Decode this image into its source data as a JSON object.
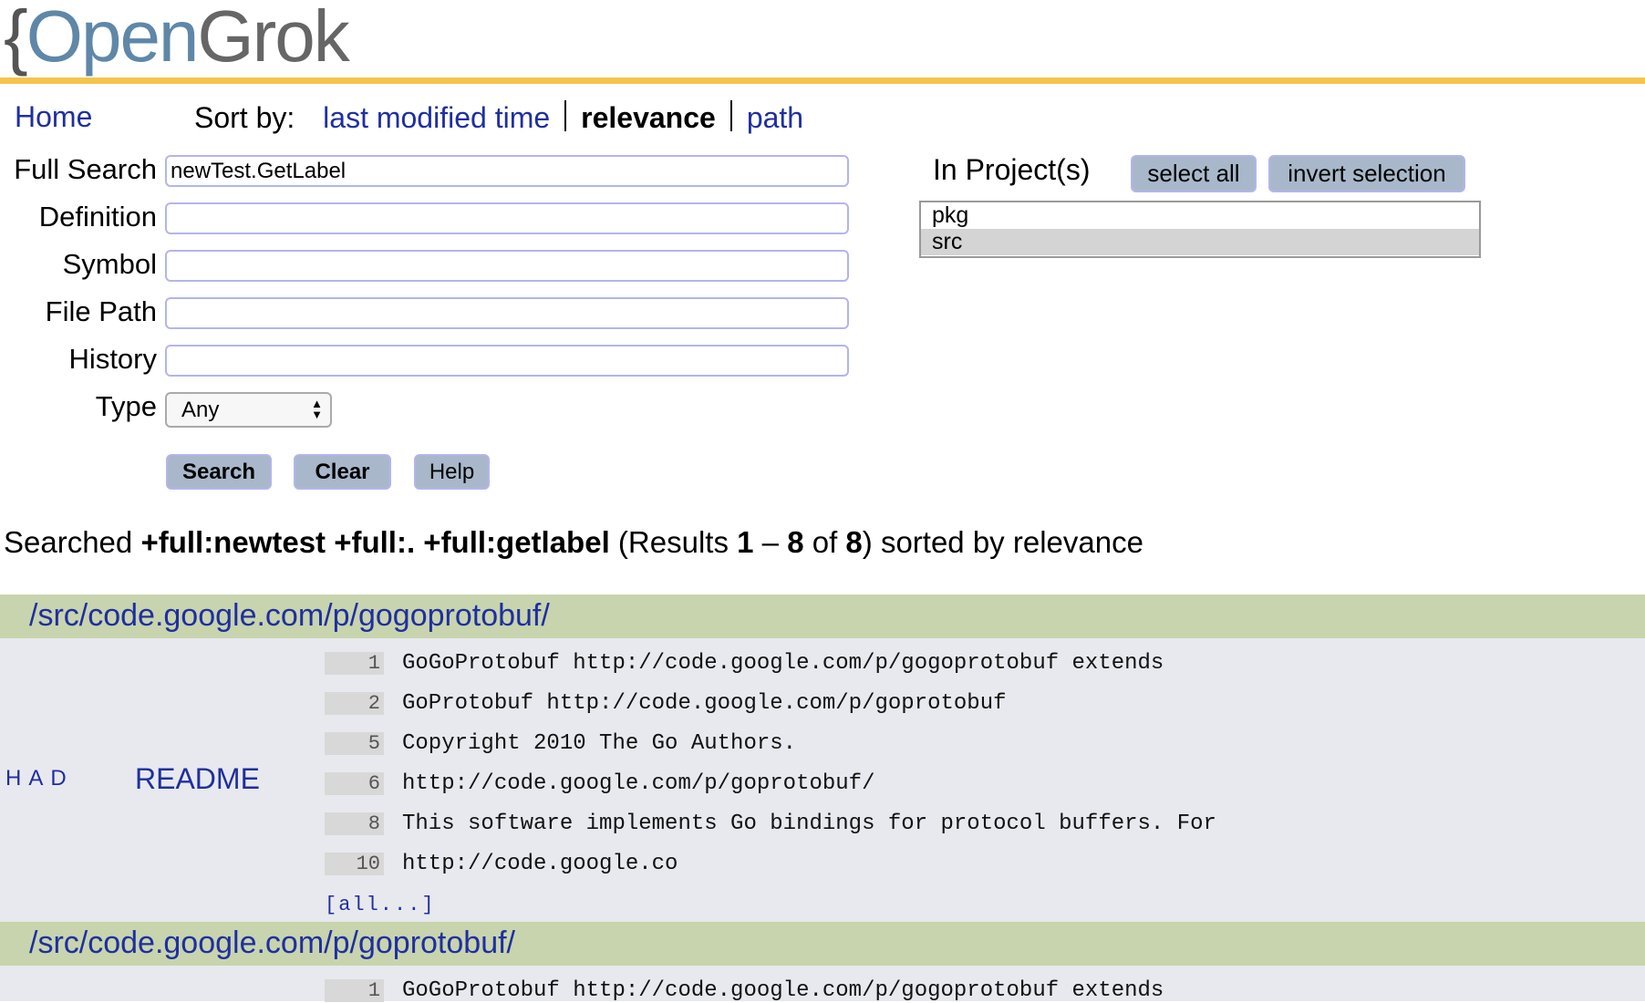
{
  "logo": {
    "brace": "{",
    "open": "Open",
    "grok": "Grok"
  },
  "colors": {
    "accent_rule": "#f4c44d",
    "link": "#1f2f9f",
    "result_header": "#c8d4ae",
    "result_bg": "#e8e9ee",
    "button": "#a8b8ca"
  },
  "nav": {
    "home": "Home",
    "sort_by": "Sort by:",
    "sort_options": [
      "last modified time",
      "relevance",
      "path"
    ],
    "active_sort": "relevance"
  },
  "form": {
    "labels": {
      "full": "Full Search",
      "defs": "Definition",
      "refs": "Symbol",
      "path": "File Path",
      "hist": "History",
      "type": "Type"
    },
    "values": {
      "full": "newTest.GetLabel",
      "defs": "",
      "refs": "",
      "path": "",
      "hist": ""
    },
    "type_selected": "Any",
    "buttons": {
      "search": "Search",
      "clear": "Clear",
      "help": "Help"
    }
  },
  "projects": {
    "label": "In Project(s)",
    "select_all": "select all",
    "invert": "invert selection",
    "items": [
      {
        "name": "pkg",
        "selected": false
      },
      {
        "name": "src",
        "selected": true
      }
    ]
  },
  "summary": {
    "searched": "Searched",
    "query": "+full:newtest +full:. +full:getlabel",
    "results_open": "(Results",
    "from": "1",
    "dash": "–",
    "to": "8",
    "of": "of",
    "total": "8",
    "tail": ") sorted by relevance"
  },
  "results": [
    {
      "dir": "/src/code.google.com/p/gogoprotobuf/",
      "flags": "HAD",
      "file": "README",
      "lines": [
        {
          "n": "1",
          "text": "GoGoProtobuf http://code.google.com/p/gogoprotobuf extends"
        },
        {
          "n": "2",
          "text": "GoProtobuf http://code.google.com/p/goprotobuf"
        },
        {
          "n": "5",
          "text": "Copyright 2010 The Go Authors."
        },
        {
          "n": "6",
          "text": "http://code.google.com/p/goprotobuf/"
        },
        {
          "n": "8",
          "text": "This software implements Go bindings for protocol buffers. For"
        },
        {
          "n": "10",
          "text": "http://code.google.co"
        }
      ],
      "more": "[all...]"
    },
    {
      "dir": "/src/code.google.com/p/goprotobuf/",
      "lines": [
        {
          "n": "1",
          "text": "GoGoProtobuf http://code.google.com/p/gogoprotobuf extends"
        }
      ]
    }
  ]
}
